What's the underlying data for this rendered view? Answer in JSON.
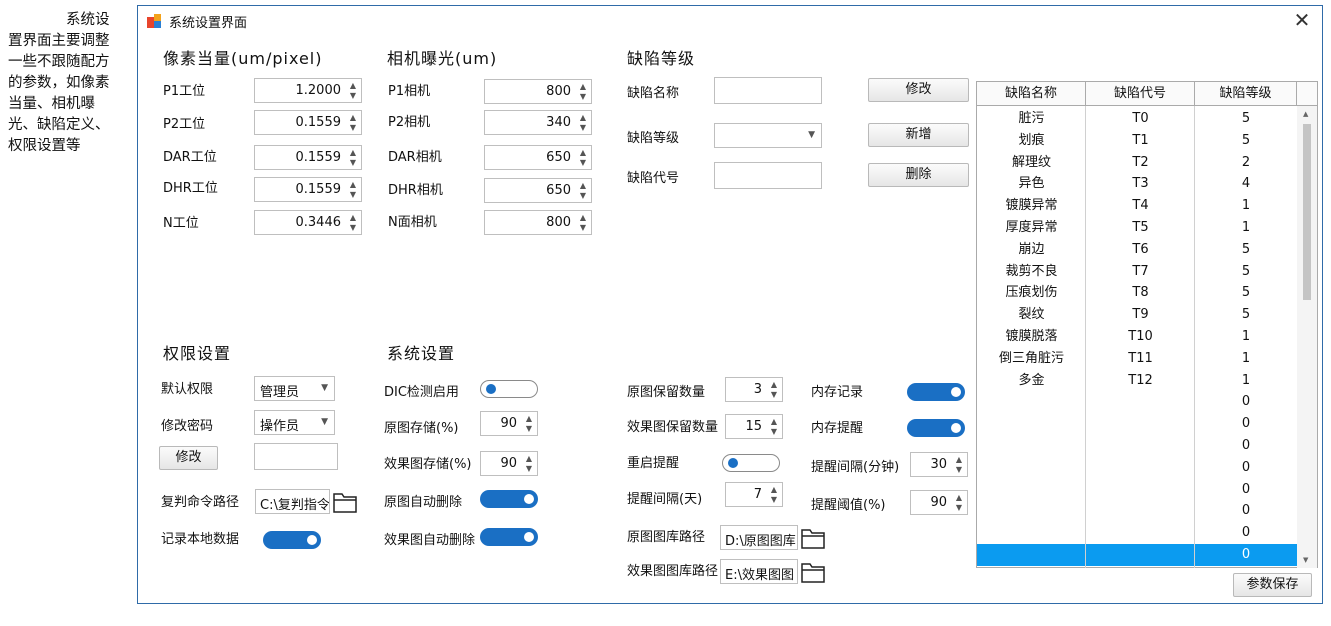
{
  "note": "系统设置界面主要调整一些不跟随配方的参数，如像素当量、相机曝光、缺陷定义、权限设置等",
  "window": {
    "title": "系统设置界面",
    "close": "✕"
  },
  "pixel": {
    "heading": "像素当量(um/pixel)",
    "rows": [
      {
        "label": "P1工位",
        "value": "1.2000"
      },
      {
        "label": "P2工位",
        "value": "0.1559"
      },
      {
        "label": "DAR工位",
        "value": "0.1559"
      },
      {
        "label": "DHR工位",
        "value": "0.1559"
      },
      {
        "label": "N工位",
        "value": "0.3446"
      }
    ]
  },
  "camera": {
    "heading": "相机曝光(um)",
    "rows": [
      {
        "label": "P1相机",
        "value": "800"
      },
      {
        "label": "P2相机",
        "value": "340"
      },
      {
        "label": "DAR相机",
        "value": "650"
      },
      {
        "label": "DHR相机",
        "value": "650"
      },
      {
        "label": "N面相机",
        "value": "800"
      }
    ]
  },
  "defect": {
    "heading": "缺陷等级",
    "name_label": "缺陷名称",
    "level_label": "缺陷等级",
    "code_label": "缺陷代号",
    "modify": "修改",
    "add": "新增",
    "delete": "删除"
  },
  "table": {
    "headers": [
      "缺陷名称",
      "缺陷代号",
      "缺陷等级"
    ],
    "rows": [
      [
        "脏污",
        "T0",
        "5"
      ],
      [
        "划痕",
        "T1",
        "5"
      ],
      [
        "解理纹",
        "T2",
        "2"
      ],
      [
        "异色",
        "T3",
        "4"
      ],
      [
        "镀膜异常",
        "T4",
        "1"
      ],
      [
        "厚度异常",
        "T5",
        "1"
      ],
      [
        "崩边",
        "T6",
        "5"
      ],
      [
        "裁剪不良",
        "T7",
        "5"
      ],
      [
        "压痕划伤",
        "T8",
        "5"
      ],
      [
        "裂纹",
        "T9",
        "5"
      ],
      [
        "镀膜脱落",
        "T10",
        "1"
      ],
      [
        "倒三角脏污",
        "T11",
        "1"
      ],
      [
        "多金",
        "T12",
        "1"
      ],
      [
        "",
        "",
        "0"
      ],
      [
        "",
        "",
        "0"
      ],
      [
        "",
        "",
        "0"
      ],
      [
        "",
        "",
        "0"
      ],
      [
        "",
        "",
        "0"
      ],
      [
        "",
        "",
        "0"
      ],
      [
        "",
        "",
        "0"
      ],
      [
        "",
        "",
        "0"
      ]
    ],
    "save": "参数保存"
  },
  "perm": {
    "heading": "权限设置",
    "default_label": "默认权限",
    "default_value": "管理员",
    "pwd_label": "修改密码",
    "pwd_value": "操作员",
    "modify": "修改",
    "cmd_label": "复判命令路径",
    "cmd_value": "C:\\复判指令",
    "local_label": "记录本地数据"
  },
  "sys": {
    "heading": "系统设置",
    "dic_label": "DIC检测启用",
    "raw_store_label": "原图存储(%)",
    "raw_store_value": "90",
    "eff_store_label": "效果图存储(%)",
    "eff_store_value": "90",
    "raw_del_label": "原图自动删除",
    "eff_del_label": "效果图自动删除",
    "raw_keep_label": "原图保留数量",
    "raw_keep_value": "3",
    "eff_keep_label": "效果图保留数量",
    "eff_keep_value": "15",
    "restart_label": "重启提醒",
    "interval_day_label": "提醒间隔(天)",
    "interval_day_value": "7",
    "raw_lib_label": "原图图库路径",
    "raw_lib_value": "D:\\原图图库",
    "eff_lib_label": "效果图图库路径",
    "eff_lib_value": "E:\\效果图图",
    "mem_rec_label": "内存记录",
    "mem_warn_label": "内存提醒",
    "interval_min_label": "提醒间隔(分钟)",
    "interval_min_value": "30",
    "threshold_label": "提醒阈值(%)",
    "threshold_value": "90"
  },
  "colors": {
    "accent": "#1a6fc4",
    "selection": "#0b9bf0",
    "border": "#2f6ba8"
  }
}
